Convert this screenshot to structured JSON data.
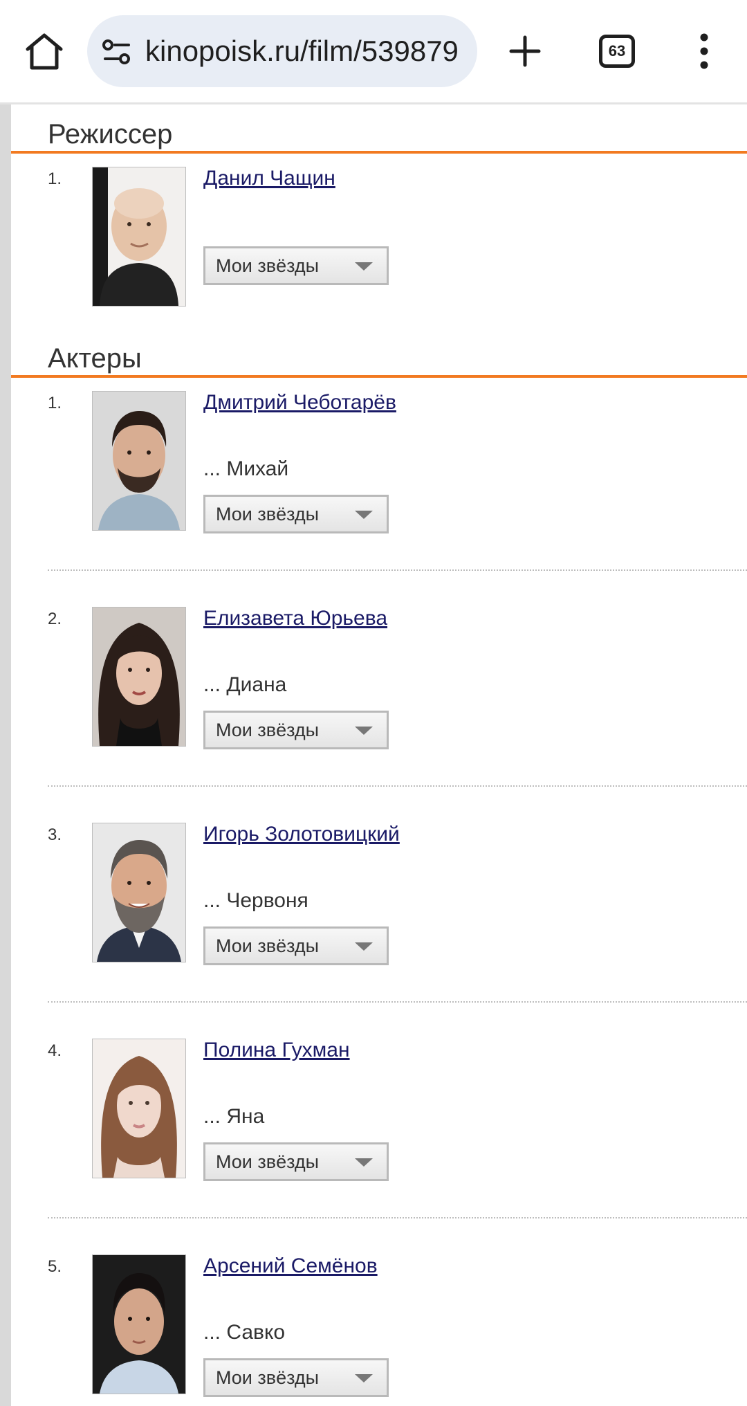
{
  "browser": {
    "url": "kinopoisk.ru/film/539879",
    "tab_count": "63",
    "icons": {
      "home": "home-icon",
      "site_info": "site-settings-icon",
      "new_tab": "plus-icon",
      "tabs": "tab-switcher-icon",
      "menu": "more-vertical-icon"
    }
  },
  "colors": {
    "accent_rule": "#f27a21",
    "link": "#1a1a66"
  },
  "director_section": {
    "title": "Режиссер",
    "items": [
      {
        "num": "1.",
        "name": "Данил Чащин",
        "role": "",
        "stars": "Мои звёзды"
      }
    ]
  },
  "actors_section": {
    "title": "Актеры",
    "items": [
      {
        "num": "1.",
        "name": "Дмитрий Чеботарёв",
        "role": "... Михай",
        "stars": "Мои звёзды"
      },
      {
        "num": "2.",
        "name": "Елизавета Юрьева",
        "role": "... Диана",
        "stars": "Мои звёзды"
      },
      {
        "num": "3.",
        "name": "Игорь Золотовицкий",
        "role": "... Червоня",
        "stars": "Мои звёзды"
      },
      {
        "num": "4.",
        "name": "Полина Гухман",
        "role": "... Яна",
        "stars": "Мои звёзды"
      },
      {
        "num": "5.",
        "name": "Арсений Семёнов",
        "role": "... Савко",
        "stars": "Мои звёзды"
      }
    ]
  }
}
